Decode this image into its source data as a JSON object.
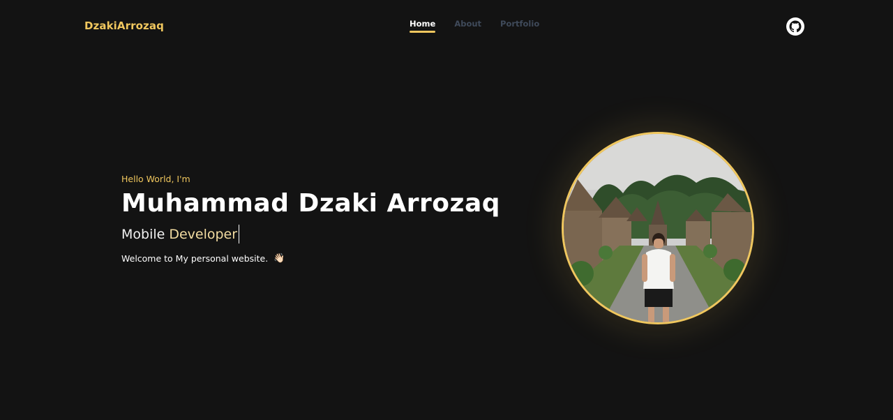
{
  "navbar": {
    "brand": "DzakiArrozaq",
    "links": [
      {
        "label": "Home",
        "active": true
      },
      {
        "label": "About",
        "active": false
      },
      {
        "label": "Portfolio",
        "active": false
      }
    ],
    "github_icon": "github-icon"
  },
  "hero": {
    "greeting": "Hello World, I'm",
    "name": "Muhammad Dzaki Arrozaq",
    "role_prefix": "Mobile",
    "role_word": "Developer",
    "welcome": "Welcome to My personal website.",
    "welcome_icon": "👋🏻"
  },
  "portrait": {
    "icon": "profile-photo"
  },
  "colors": {
    "accent": "#f0c75e",
    "background": "#131313",
    "nav_inactive": "#3f4a5a"
  }
}
